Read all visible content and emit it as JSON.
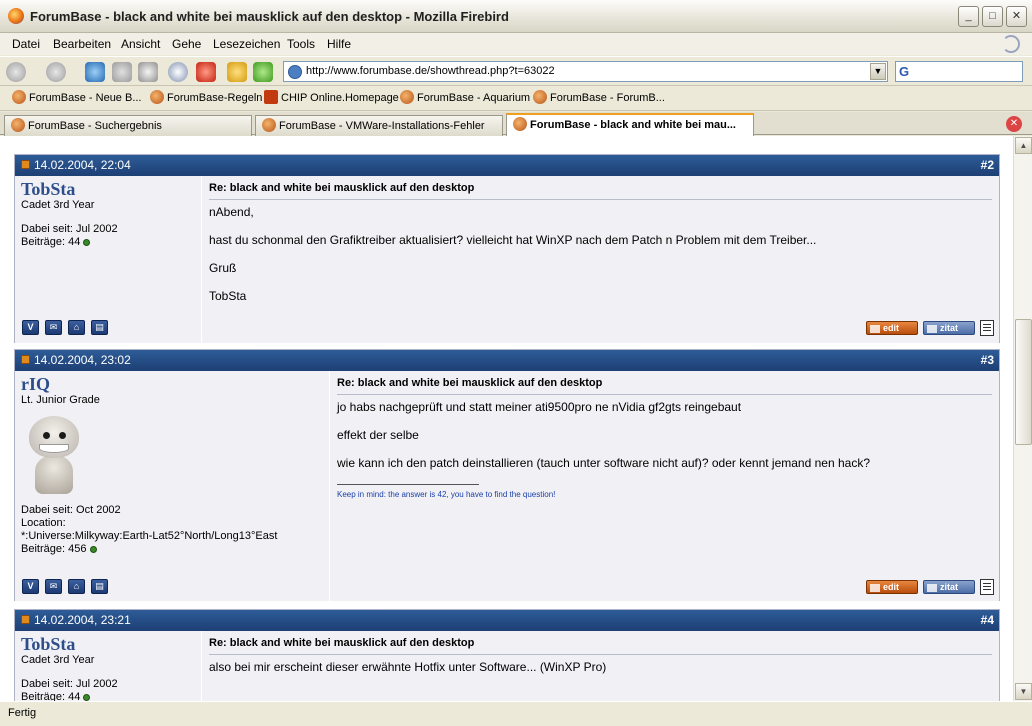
{
  "window": {
    "title": "ForumBase - black and white bei mausklick auf den desktop - Mozilla Firebird"
  },
  "menu": [
    "Datei",
    "Bearbeiten",
    "Ansicht",
    "Gehe",
    "Lesezeichen",
    "Tools",
    "Hilfe"
  ],
  "address": {
    "url": "http://www.forumbase.de/showthread.php?t=63022"
  },
  "search": {
    "engine_glyph": "G"
  },
  "bookmarks": [
    "ForumBase - Neue B...",
    "ForumBase-Regeln",
    "CHIP Online.Homepage",
    "ForumBase - Aquarium",
    "ForumBase - ForumB..."
  ],
  "tabs": [
    "ForumBase - Suchergebnis",
    "ForumBase - VMWare-Installations-Fehler",
    "ForumBase - black and white bei mau..."
  ],
  "posts": [
    {
      "date": "14.02.2004, 22:04",
      "number": "#2",
      "username": "TobSta",
      "rank": "Cadet 3rd Year",
      "joined": "Dabei seit: Jul 2002",
      "posts": "Beiträge: 44",
      "subject": "Re: black and white bei mausklick auf den desktop",
      "lines": [
        "nAbend,",
        "hast du schonmal den Grafiktreiber aktualisiert? vielleicht hat WinXP nach dem Patch n Problem mit dem Treiber...",
        "Gruß",
        "TobSta"
      ]
    },
    {
      "date": "14.02.2004, 23:02",
      "number": "#3",
      "username": "rIQ",
      "rank": "Lt. Junior Grade",
      "joined": "Dabei seit: Oct 2002",
      "location_label": "Location:",
      "location": "*:Universe:Milkyway:Earth-Lat52°North/Long13°East",
      "posts": "Beiträge: 456",
      "subject": "Re: black and white bei mausklick auf den desktop",
      "lines": [
        "jo habs nachgeprüft und statt meiner ati9500pro ne nVidia gf2gts reingebaut",
        "effekt der selbe",
        "wie kann ich den patch deinstallieren (tauch unter software nicht auf)? oder kennt jemand nen hack?"
      ],
      "signature": "Keep in mind: the answer is 42, you have to find the question!"
    },
    {
      "date": "14.02.2004, 23:21",
      "number": "#4",
      "username": "TobSta",
      "rank": "Cadet 3rd Year",
      "joined": "Dabei seit: Jul 2002",
      "posts": "Beiträge: 44",
      "subject": "Re: black and white bei mausklick auf den desktop",
      "lines": [
        "also bei mir erscheint dieser erwähnte Hotfix unter Software... (WinXP Pro)"
      ]
    }
  ],
  "buttons": {
    "edit": "edit",
    "quote": "zitat"
  },
  "status": "Fertig",
  "colors": {
    "post_header": "#1d3f74",
    "username": "#2d4e8b",
    "edit_button": "#b94d0e",
    "quote_button": "#4e6ea8"
  }
}
